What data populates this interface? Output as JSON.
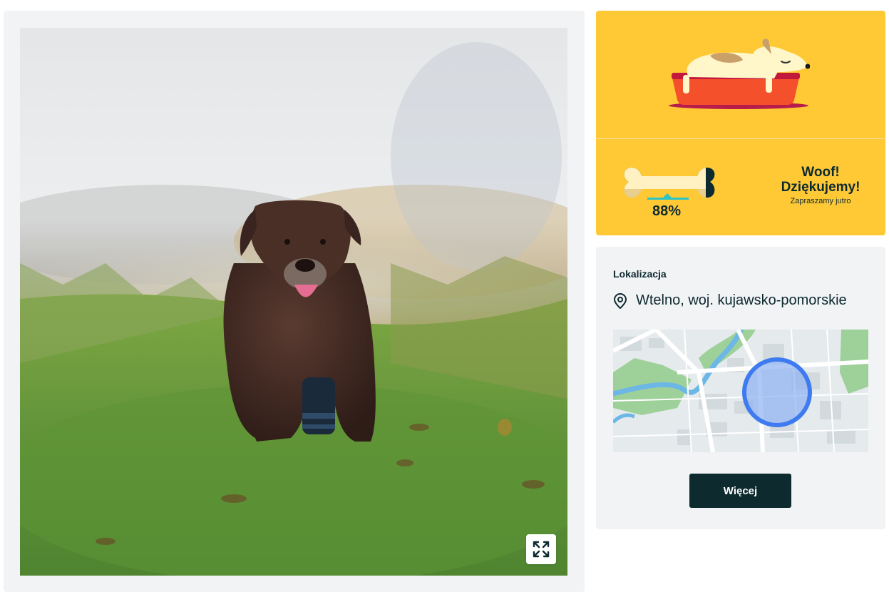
{
  "photo": {
    "alt_icon": "dog-photo",
    "expand_icon": "expand-icon"
  },
  "status": {
    "illustration_icon": "sleeping-dog-icon",
    "bone_icon": "bone-progress-icon",
    "progress_fraction": 0.88,
    "percent_label": "88%",
    "thanks_line1": "Woof!",
    "thanks_line2": "Dziękujemy!",
    "thanks_line3": "Zapraszamy jutro",
    "background_color": "#ffc936",
    "text_color": "#0d2a2f"
  },
  "location": {
    "title": "Lokalizacja",
    "pin_icon": "location-pin-icon",
    "place": "Wtelno, woj. kujawsko-pomorskie",
    "map_icon": "map-image",
    "more_label": "Więcej",
    "button_color": "#0d2a2f",
    "marker_color": "#3f7bf0"
  }
}
